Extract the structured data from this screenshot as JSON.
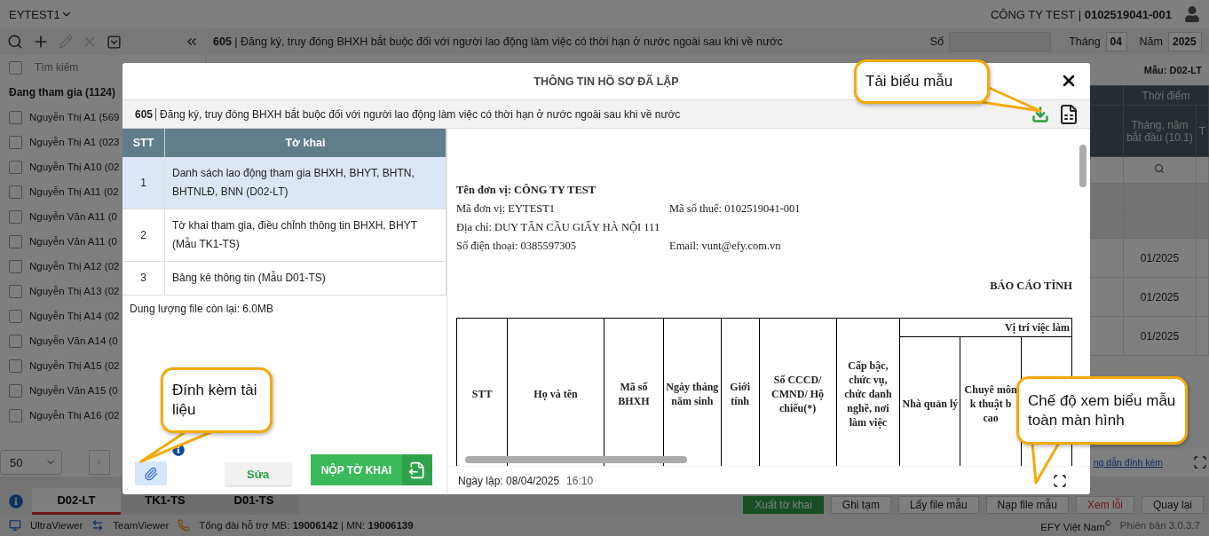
{
  "header": {
    "company_code": "EYTEST1",
    "company": "CÔNG TY TEST | **0102519041-001**"
  },
  "toolbar": {
    "title": "**605** | Đăng ký, truy đóng BHXH bắt buộc đối với người lao động làm việc có thời hạn ở nước ngoài sau khi về nước",
    "number_label": "Số",
    "month_label": "Tháng",
    "month": "04",
    "year_label": "Năm",
    "year": "2025"
  },
  "sidebar": {
    "select_all_checked": false,
    "search_placeholder": "Tìm kiếm",
    "group": "Đang tham gia (1124)",
    "items": [
      {
        "name": "Nguyễn Thị A1 (569",
        "checked": false
      },
      {
        "name": "Nguyễn Thị A1 (023",
        "checked": false
      },
      {
        "name": "Nguyễn Thị A10 (02",
        "checked": false
      },
      {
        "name": "Nguyễn Thị A11 (02",
        "checked": false
      },
      {
        "name": "Nguyễn Văn A11 (0",
        "checked": false
      },
      {
        "name": "Nguyễn Văn A11 (0",
        "checked": false
      },
      {
        "name": "Nguyễn Thị A12 (02",
        "checked": false
      },
      {
        "name": "Nguyễn Thị A13 (02",
        "checked": false
      },
      {
        "name": "Nguyễn Thị A14 (02",
        "checked": false
      },
      {
        "name": "Nguyễn Văn A14 (0",
        "checked": false
      },
      {
        "name": "Nguyễn Thị A15 (02",
        "checked": false
      },
      {
        "name": "Nguyễn Văn A15 (0",
        "checked": false
      },
      {
        "name": "Nguyễn Thị A16 (02",
        "checked": false
      }
    ],
    "page_size": "50"
  },
  "content": {
    "template_label": "Mẫu: D02-LT",
    "group_column": "Thời điểm",
    "column": "Tháng, năm bắt đầu (10.1)",
    "column_2": "T",
    "rows": [
      "01/2025",
      "01/2025",
      "01/2025"
    ],
    "guide_link": "ng dẫn đính kèm"
  },
  "bottom_tabs": [
    {
      "label": "D02-LT",
      "selected": true
    },
    {
      "label": "TK1-TS",
      "selected": false
    },
    {
      "label": "D01-TS",
      "selected": false
    }
  ],
  "actions": [
    {
      "label": "Xuất tờ khai",
      "kind": "primary"
    },
    {
      "label": "Ghi tạm",
      "kind": "default"
    },
    {
      "label": "Lấy file mẫu",
      "kind": "default"
    },
    {
      "label": "Nạp file mẫu",
      "kind": "default"
    },
    {
      "label": "Xem lỗi",
      "kind": "danger"
    },
    {
      "label": "Quay lại",
      "kind": "default"
    }
  ],
  "status_bar": {
    "tools": [
      {
        "kind": "monitor",
        "label": "UltraViewer"
      },
      {
        "kind": "remote",
        "label": "TeamViewer"
      }
    ],
    "hotline": "Tổng đài hỗ trợ MB: **19006142** | MN: **19006139**",
    "brand": "EFY Việt Nam$^{©}$",
    "version": "Phiên bản 3.0.3.7"
  },
  "modal": {
    "title": "THÔNG TIN HỒ SƠ ĐÃ LẬP",
    "code": "605",
    "description": "Đăng ký, truy đóng BHXH bắt buộc đối với người lao động làm việc có thời hạn ở nước ngoài sau khi về nước",
    "columns": [
      "STT",
      "Tờ khai"
    ],
    "forms": [
      {
        "stt": "1",
        "label": "Danh sách lao động tham gia BHXH, BHYT, BHTN, BHTNLĐ, BNN (D02-LT)",
        "selected": true
      },
      {
        "stt": "2",
        "label": "Tờ khai tham gia, điều chỉnh thông tin BHXH, BHYT (Mẫu TK1-TS)",
        "selected": false
      },
      {
        "stt": "3",
        "label": "Bảng kê thông tin (Mẫu D01-TS)",
        "selected": false
      }
    ],
    "storage": "Dung lượng file còn lại: 6.0MB",
    "edit_button": "Sửa",
    "submit_button": "NỘP TỜ KHAI",
    "date": "Ngày lập: 08/04/2025",
    "time": "16:10",
    "document": {
      "unit_name": "Tên đơn vị: CÔNG TY TEST",
      "unit_code": "Mã đơn vị: EYTEST1",
      "tax_code": "Mã số thuế: 0102519041-001",
      "address": "Địa chỉ: DUY TÂN CẦU GIẤY HÀ NỘI 111",
      "phone": "Số điện thoại: 0385597305",
      "email": "Email: vunt@efy.com.vn",
      "report_title": "BÁO CÁO TÌNH",
      "columns": [
        "STT",
        "Họ và tên",
        "Mã số BHXH",
        "Ngày tháng năm sinh",
        "Giới tính",
        "Số CCCD/ CMND/ Hộ chiếu(*)",
        "Cấp bậc, chức vụ, chức danh nghề, nơi làm việc"
      ],
      "group_column": "Vị trí việc làm",
      "sub_columns": [
        "Nhà quản lý",
        "Chuyê môn k thuật b cao"
      ]
    }
  },
  "callouts": [
    {
      "text": "Tải biểu mẫu"
    },
    {
      "text": "Đính kèm tài liệu"
    },
    {
      "text": "Chế độ xem biểu mẫu toàn màn hình"
    }
  ]
}
